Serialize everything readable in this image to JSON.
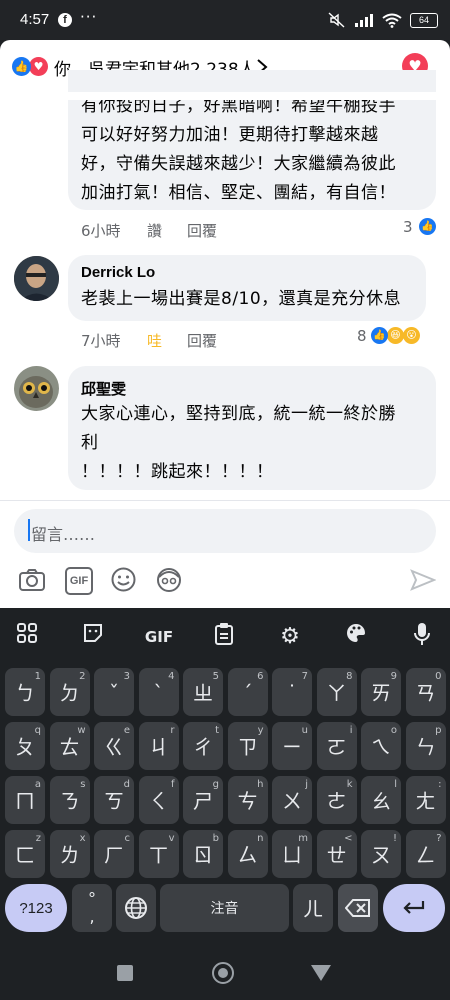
{
  "status": {
    "time": "4:57",
    "battery": "64"
  },
  "reactions_bar": {
    "text": "你、吳君宇和其他2,238人"
  },
  "comments": [
    {
      "lines": [
        "有你投的日子，好黑暗啊！希望牛棚投手",
        "可以好好努力加油！更期待打擊越來越",
        "好，守備失誤越來越少！大家繼續為彼此",
        "加油打氣！相信、堅定、團結，有自信！"
      ],
      "time": "6小時",
      "like_label": "讚",
      "reply_label": "回覆",
      "reaction_count": "3"
    },
    {
      "author": "Derrick Lo",
      "lines": [
        "老裴上一場出賽是8/10，還真是充分休息"
      ],
      "time": "7小時",
      "like_label": "哇",
      "reply_label": "回覆",
      "reaction_count": "8"
    },
    {
      "author": "邱聖雯",
      "lines": [
        "大家心連心，堅持到底，統一統一終於勝",
        "利",
        "！！！！跳起來！！！！"
      ]
    }
  ],
  "composer": {
    "placeholder": "留言……",
    "gif_label": "GIF"
  },
  "keyboard": {
    "toolbar_gif": "GIF",
    "row1": [
      [
        "ㄅ",
        "1"
      ],
      [
        "ㄉ",
        "2"
      ],
      [
        "ˇ",
        "3"
      ],
      [
        "ˋ",
        "4"
      ],
      [
        "ㄓ",
        "5"
      ],
      [
        "ˊ",
        "6"
      ],
      [
        "˙",
        "7"
      ],
      [
        "ㄚ",
        "8"
      ],
      [
        "ㄞ",
        "9"
      ],
      [
        "ㄢ",
        "0"
      ]
    ],
    "row2": [
      [
        "ㄆ",
        "q"
      ],
      [
        "ㄊ",
        "w"
      ],
      [
        "ㄍ",
        "e"
      ],
      [
        "ㄐ",
        "r"
      ],
      [
        "ㄔ",
        "t"
      ],
      [
        "ㄗ",
        "y"
      ],
      [
        "ㄧ",
        "u"
      ],
      [
        "ㄛ",
        "i"
      ],
      [
        "ㄟ",
        "o"
      ],
      [
        "ㄣ",
        "p"
      ]
    ],
    "row3": [
      [
        "ㄇ",
        "a"
      ],
      [
        "ㄋ",
        "s"
      ],
      [
        "ㄎ",
        "d"
      ],
      [
        "ㄑ",
        "f"
      ],
      [
        "ㄕ",
        "g"
      ],
      [
        "ㄘ",
        "h"
      ],
      [
        "ㄨ",
        "j"
      ],
      [
        "ㄜ",
        "k"
      ],
      [
        "ㄠ",
        "l"
      ],
      [
        "ㄤ",
        ":"
      ]
    ],
    "row4": [
      [
        "ㄈ",
        "z"
      ],
      [
        "ㄌ",
        "x"
      ],
      [
        "ㄏ",
        "c"
      ],
      [
        "ㄒ",
        "v"
      ],
      [
        "ㄖ",
        "b"
      ],
      [
        "ㄙ",
        "n"
      ],
      [
        "ㄩ",
        "m"
      ],
      [
        "ㄝ",
        "<"
      ],
      [
        "ㄡ",
        "!"
      ],
      [
        "ㄥ",
        "?"
      ]
    ],
    "symbols_label": "?123",
    "punct_top": "°",
    "punct_bottom": ",",
    "space_label": "注音",
    "er_label": "ㄦ"
  }
}
